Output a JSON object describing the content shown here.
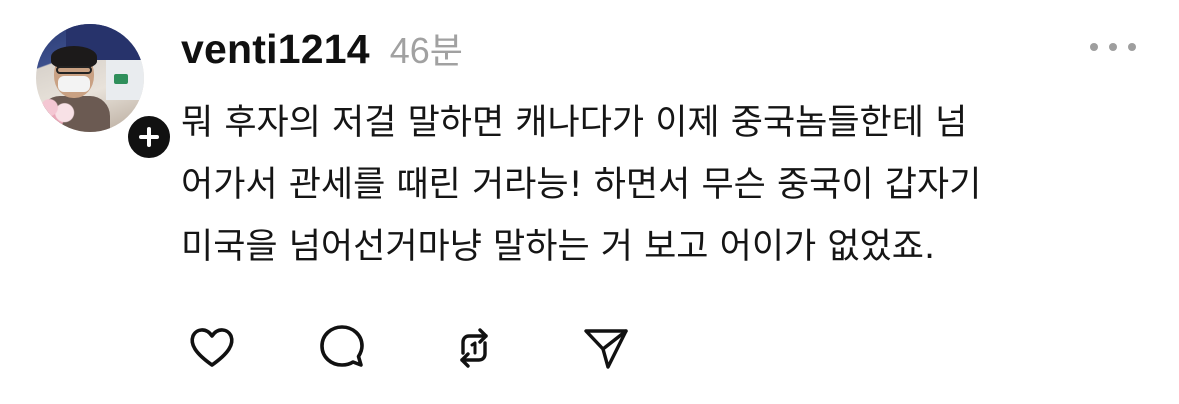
{
  "post": {
    "username": "venti1214",
    "time": "46분",
    "body_lines": [
      "뭐 후자의 저걸 말하면 캐나다가 이제 중국놈들한테 넘",
      "어가서 관세를 때린 거라능! 하면서 무슨 중국이 갑자기",
      "미국을 넘어선거마냥 말하는 거 보고 어이가 없었죠."
    ]
  },
  "icons": {
    "follow": "plus-icon",
    "more": "more-horizontal-icon",
    "like": "heart-icon",
    "reply": "comment-bubble-icon",
    "repost": "repost-arrows-icon",
    "share": "send-paper-plane-icon"
  },
  "colors": {
    "text": "#151515",
    "muted": "#a1a1a1",
    "follow_badge": "#111111"
  }
}
